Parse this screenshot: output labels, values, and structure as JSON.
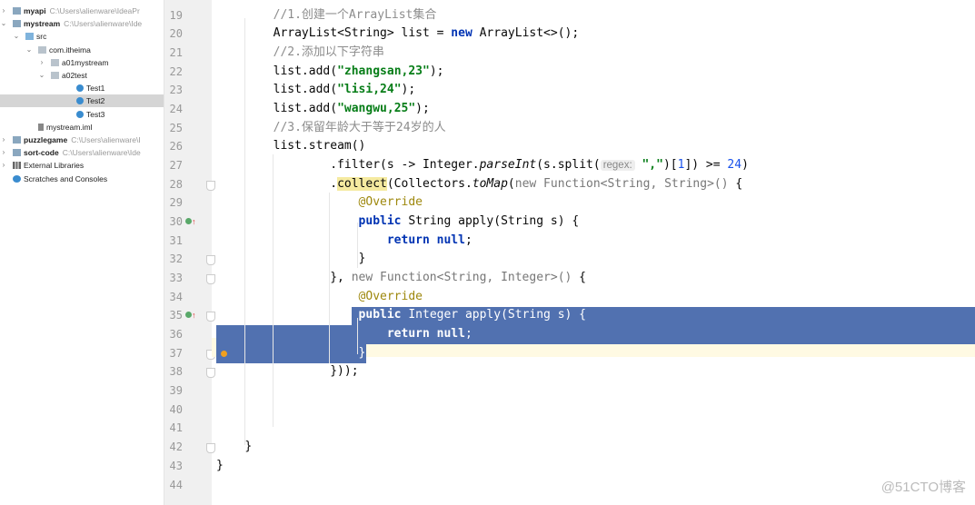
{
  "project_tree": [
    {
      "label": "myapi",
      "path": "C:\\Users\\alienware\\IdeaPr",
      "bold": true,
      "indent": 0,
      "arrow": ">",
      "icon": "module-folder"
    },
    {
      "label": "mystream",
      "path": "C:\\Users\\alienware\\Ide",
      "bold": true,
      "indent": 0,
      "arrow": "v",
      "icon": "module-folder"
    },
    {
      "label": "src",
      "indent": 1,
      "arrow": "v",
      "icon": "source-folder"
    },
    {
      "label": "com.itheima",
      "indent": 2,
      "arrow": "v",
      "icon": "package"
    },
    {
      "label": "a01mystream",
      "indent": 3,
      "arrow": ">",
      "icon": "package"
    },
    {
      "label": "a02test",
      "indent": 3,
      "arrow": "v",
      "icon": "package"
    },
    {
      "label": "Test1",
      "indent": 5,
      "icon": "class"
    },
    {
      "label": "Test2",
      "indent": 5,
      "icon": "class",
      "selected": true
    },
    {
      "label": "Test3",
      "indent": 5,
      "icon": "class"
    },
    {
      "label": "mystream.iml",
      "indent": 2,
      "icon": "iml-file"
    },
    {
      "label": "puzzlegame",
      "path": "C:\\Users\\alienware\\I",
      "bold": true,
      "indent": 0,
      "arrow": ">",
      "icon": "module-folder"
    },
    {
      "label": "sort-code",
      "path": "C:\\Users\\alienware\\Ide",
      "bold": true,
      "indent": 0,
      "arrow": ">",
      "icon": "module-folder"
    },
    {
      "label": "External Libraries",
      "indent": 0,
      "arrow": ">",
      "icon": "library"
    },
    {
      "label": "Scratches and Consoles",
      "indent": 0,
      "icon": "scratches"
    }
  ],
  "code_lines": [
    {
      "n": "19",
      "indent": 2,
      "t": [
        [
          "//1.创建一个ArrayList集合",
          "cm"
        ]
      ]
    },
    {
      "n": "20",
      "indent": 2,
      "t": [
        [
          "ArrayList<String> list = ",
          ""
        ],
        [
          "new",
          "kw"
        ],
        [
          " ArrayList<>();",
          ""
        ]
      ]
    },
    {
      "n": "21",
      "indent": 2,
      "t": [
        [
          "//2.添加以下字符串",
          "cm"
        ]
      ]
    },
    {
      "n": "22",
      "indent": 2,
      "t": [
        [
          "list.add(",
          ""
        ],
        [
          "\"zhangsan,23\"",
          "str"
        ],
        [
          ");",
          ""
        ]
      ]
    },
    {
      "n": "23",
      "indent": 2,
      "t": [
        [
          "list.add(",
          ""
        ],
        [
          "\"lisi,24\"",
          "str"
        ],
        [
          ");",
          ""
        ]
      ]
    },
    {
      "n": "24",
      "indent": 2,
      "t": [
        [
          "list.add(",
          ""
        ],
        [
          "\"wangwu,25\"",
          "str"
        ],
        [
          ");",
          ""
        ]
      ]
    },
    {
      "n": "25",
      "indent": 2,
      "t": [
        [
          "//3.保留年龄大于等于24岁的人",
          "cm"
        ]
      ]
    },
    {
      "n": "26",
      "indent": 2,
      "t": [
        [
          "list.stream()",
          ""
        ]
      ]
    },
    {
      "n": "27",
      "indent": 4,
      "t": [
        [
          ".filter(s -> Integer.",
          ""
        ],
        [
          "parseInt",
          "it"
        ],
        [
          "(s.split(",
          ""
        ],
        [
          "regex:",
          "hint"
        ],
        [
          " ",
          ""
        ],
        [
          "\",\"",
          "str"
        ],
        [
          ")[",
          ""
        ],
        [
          "1",
          "num"
        ],
        [
          "]) >= ",
          ""
        ],
        [
          "24",
          "num"
        ],
        [
          ")",
          ""
        ]
      ]
    },
    {
      "n": "28",
      "indent": 4,
      "fold": true,
      "t": [
        [
          ".",
          ""
        ],
        [
          "collect",
          "hl"
        ],
        [
          "(Collectors.",
          ""
        ],
        [
          "toMap",
          "it"
        ],
        [
          "(",
          ""
        ],
        [
          "new Function<String, String>()",
          "dim"
        ],
        [
          " {",
          ""
        ]
      ]
    },
    {
      "n": "29",
      "indent": 5,
      "t": [
        [
          "@Override",
          "ann"
        ]
      ]
    },
    {
      "n": "30",
      "indent": 5,
      "mark": true,
      "t": [
        [
          "public",
          "kw"
        ],
        [
          " String apply(String s) {",
          ""
        ]
      ]
    },
    {
      "n": "31",
      "indent": 6,
      "t": [
        [
          "return",
          "kw"
        ],
        [
          " ",
          ""
        ],
        [
          "null",
          "kw"
        ],
        [
          ";",
          ""
        ]
      ]
    },
    {
      "n": "32",
      "indent": 5,
      "fold": true,
      "t": [
        [
          "}",
          ""
        ]
      ]
    },
    {
      "n": "33",
      "indent": 4,
      "fold": true,
      "t": [
        [
          "}, ",
          ""
        ],
        [
          "new Function<String, Integer>()",
          "dim"
        ],
        [
          " {",
          ""
        ]
      ]
    },
    {
      "n": "34",
      "indent": 5,
      "t": [
        [
          "@Override",
          "ann"
        ]
      ]
    },
    {
      "n": "35",
      "indent": 5,
      "mark": true,
      "fold": true,
      "sel": true,
      "t": [
        [
          "public",
          "kw"
        ],
        [
          " Integer apply(String s) {",
          ""
        ]
      ]
    },
    {
      "n": "36",
      "indent": 6,
      "sel": true,
      "t": [
        [
          "return",
          "kw"
        ],
        [
          " ",
          ""
        ],
        [
          "null",
          "kw"
        ],
        [
          ";",
          ""
        ]
      ]
    },
    {
      "n": "37",
      "indent": 5,
      "fold": true,
      "sel": true,
      "t": [
        [
          "}",
          ""
        ]
      ]
    },
    {
      "n": "38",
      "indent": 4,
      "fold": true,
      "t": [
        [
          "}));",
          ""
        ]
      ]
    },
    {
      "n": "39",
      "indent": 0,
      "t": []
    },
    {
      "n": "40",
      "indent": 0,
      "t": []
    },
    {
      "n": "41",
      "indent": 0,
      "t": []
    },
    {
      "n": "42",
      "indent": 1,
      "fold": true,
      "t": [
        [
          "}",
          ""
        ]
      ]
    },
    {
      "n": "43",
      "indent": 0,
      "t": [
        [
          "}",
          ""
        ]
      ]
    },
    {
      "n": "44",
      "indent": 0,
      "t": []
    }
  ],
  "watermark": "@51CTO博客"
}
